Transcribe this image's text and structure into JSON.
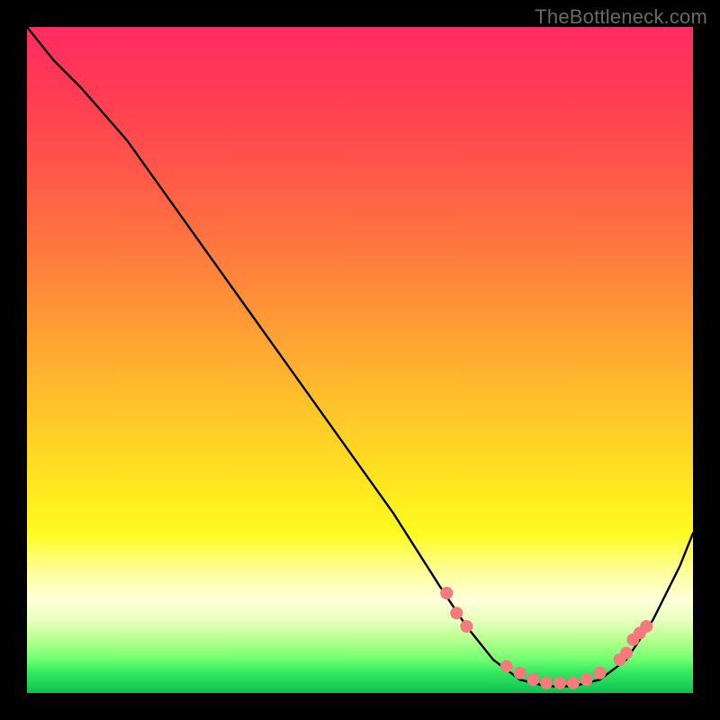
{
  "watermark": "TheBottleneck.com",
  "chart_data": {
    "type": "line",
    "title": "",
    "xlabel": "",
    "ylabel": "",
    "xlim": [
      0,
      100
    ],
    "ylim": [
      0,
      100
    ],
    "grid": false,
    "series": [
      {
        "name": "curve",
        "color": "#000000",
        "x": [
          0,
          4,
          8,
          15,
          25,
          35,
          45,
          55,
          62,
          66,
          70,
          74,
          78,
          82,
          86,
          90,
          94,
          98,
          100
        ],
        "y": [
          100,
          95,
          91,
          83,
          69,
          55,
          41,
          27,
          16,
          10,
          5,
          2,
          1,
          1,
          2,
          5,
          11,
          19,
          24
        ]
      }
    ],
    "markers": [
      {
        "x": 63,
        "y": 15
      },
      {
        "x": 64.5,
        "y": 12
      },
      {
        "x": 66,
        "y": 10
      },
      {
        "x": 72,
        "y": 4
      },
      {
        "x": 74,
        "y": 3
      },
      {
        "x": 76,
        "y": 2
      },
      {
        "x": 78,
        "y": 1.5
      },
      {
        "x": 80,
        "y": 1.5
      },
      {
        "x": 82,
        "y": 1.5
      },
      {
        "x": 84,
        "y": 2
      },
      {
        "x": 86,
        "y": 3
      },
      {
        "x": 89,
        "y": 5
      },
      {
        "x": 90,
        "y": 6
      },
      {
        "x": 91,
        "y": 8
      },
      {
        "x": 92,
        "y": 9
      },
      {
        "x": 93,
        "y": 10
      }
    ],
    "marker_color": "#f47b7b",
    "marker_radius": 7
  }
}
